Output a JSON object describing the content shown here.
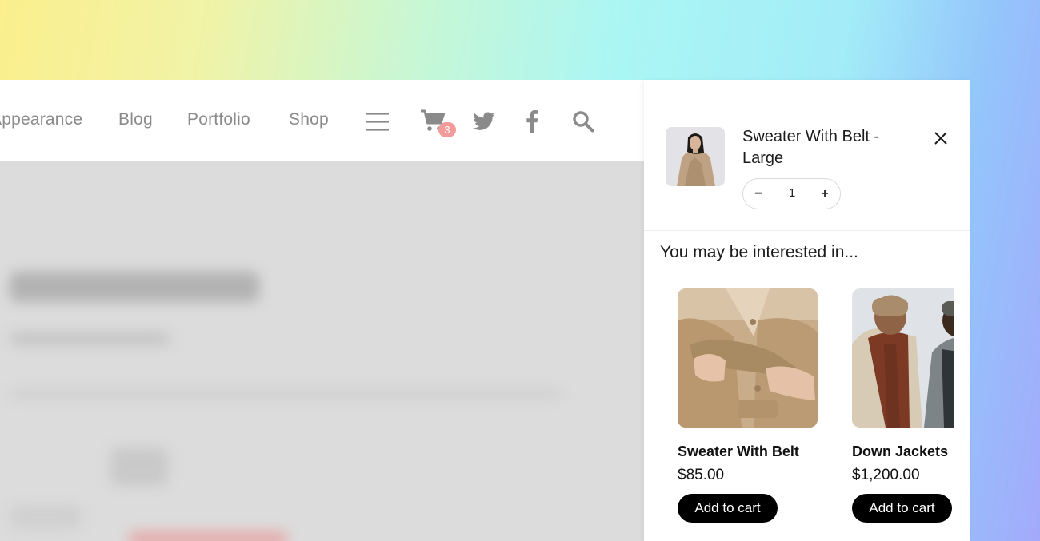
{
  "nav": {
    "links": [
      "Appearance",
      "Blog",
      "Portfolio",
      "Shop"
    ],
    "cart_count": "3",
    "icons": [
      "menu-icon",
      "cart-icon",
      "twitter-icon",
      "facebook-icon",
      "search-icon"
    ]
  },
  "cart": {
    "item_title": "Sweater With Belt - Large",
    "quantity": "1",
    "decrement_label": "−",
    "increment_label": "+",
    "close_icon": "close-icon"
  },
  "recommendations": {
    "title": "You may be interested in...",
    "items": [
      {
        "name": "Sweater With Belt",
        "price": "$85.00",
        "button": "Add to cart"
      },
      {
        "name": "Down Jackets",
        "price": "$1,200.00",
        "button": "Add to cart"
      }
    ]
  },
  "colors": {
    "accent": "#000000",
    "badge": "#f39a9a",
    "nav_text": "#8a8a8a"
  }
}
